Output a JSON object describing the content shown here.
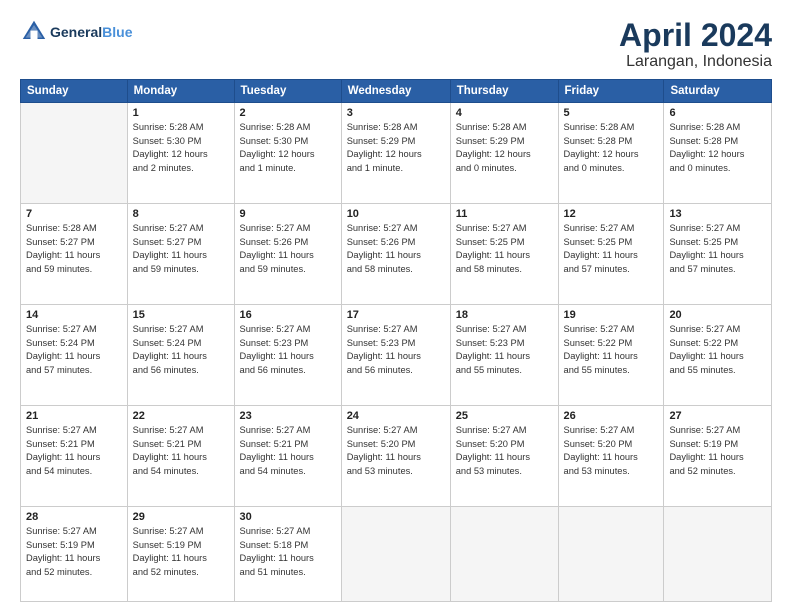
{
  "header": {
    "logo_line1": "General",
    "logo_line2": "Blue",
    "title": "April 2024",
    "subtitle": "Larangan, Indonesia"
  },
  "weekdays": [
    "Sunday",
    "Monday",
    "Tuesday",
    "Wednesday",
    "Thursday",
    "Friday",
    "Saturday"
  ],
  "weeks": [
    [
      {
        "num": "",
        "detail": ""
      },
      {
        "num": "1",
        "detail": "Sunrise: 5:28 AM\nSunset: 5:30 PM\nDaylight: 12 hours\nand 2 minutes."
      },
      {
        "num": "2",
        "detail": "Sunrise: 5:28 AM\nSunset: 5:30 PM\nDaylight: 12 hours\nand 1 minute."
      },
      {
        "num": "3",
        "detail": "Sunrise: 5:28 AM\nSunset: 5:29 PM\nDaylight: 12 hours\nand 1 minute."
      },
      {
        "num": "4",
        "detail": "Sunrise: 5:28 AM\nSunset: 5:29 PM\nDaylight: 12 hours\nand 0 minutes."
      },
      {
        "num": "5",
        "detail": "Sunrise: 5:28 AM\nSunset: 5:28 PM\nDaylight: 12 hours\nand 0 minutes."
      },
      {
        "num": "6",
        "detail": "Sunrise: 5:28 AM\nSunset: 5:28 PM\nDaylight: 12 hours\nand 0 minutes."
      }
    ],
    [
      {
        "num": "7",
        "detail": "Sunrise: 5:28 AM\nSunset: 5:27 PM\nDaylight: 11 hours\nand 59 minutes."
      },
      {
        "num": "8",
        "detail": "Sunrise: 5:27 AM\nSunset: 5:27 PM\nDaylight: 11 hours\nand 59 minutes."
      },
      {
        "num": "9",
        "detail": "Sunrise: 5:27 AM\nSunset: 5:26 PM\nDaylight: 11 hours\nand 59 minutes."
      },
      {
        "num": "10",
        "detail": "Sunrise: 5:27 AM\nSunset: 5:26 PM\nDaylight: 11 hours\nand 58 minutes."
      },
      {
        "num": "11",
        "detail": "Sunrise: 5:27 AM\nSunset: 5:25 PM\nDaylight: 11 hours\nand 58 minutes."
      },
      {
        "num": "12",
        "detail": "Sunrise: 5:27 AM\nSunset: 5:25 PM\nDaylight: 11 hours\nand 57 minutes."
      },
      {
        "num": "13",
        "detail": "Sunrise: 5:27 AM\nSunset: 5:25 PM\nDaylight: 11 hours\nand 57 minutes."
      }
    ],
    [
      {
        "num": "14",
        "detail": "Sunrise: 5:27 AM\nSunset: 5:24 PM\nDaylight: 11 hours\nand 57 minutes."
      },
      {
        "num": "15",
        "detail": "Sunrise: 5:27 AM\nSunset: 5:24 PM\nDaylight: 11 hours\nand 56 minutes."
      },
      {
        "num": "16",
        "detail": "Sunrise: 5:27 AM\nSunset: 5:23 PM\nDaylight: 11 hours\nand 56 minutes."
      },
      {
        "num": "17",
        "detail": "Sunrise: 5:27 AM\nSunset: 5:23 PM\nDaylight: 11 hours\nand 56 minutes."
      },
      {
        "num": "18",
        "detail": "Sunrise: 5:27 AM\nSunset: 5:23 PM\nDaylight: 11 hours\nand 55 minutes."
      },
      {
        "num": "19",
        "detail": "Sunrise: 5:27 AM\nSunset: 5:22 PM\nDaylight: 11 hours\nand 55 minutes."
      },
      {
        "num": "20",
        "detail": "Sunrise: 5:27 AM\nSunset: 5:22 PM\nDaylight: 11 hours\nand 55 minutes."
      }
    ],
    [
      {
        "num": "21",
        "detail": "Sunrise: 5:27 AM\nSunset: 5:21 PM\nDaylight: 11 hours\nand 54 minutes."
      },
      {
        "num": "22",
        "detail": "Sunrise: 5:27 AM\nSunset: 5:21 PM\nDaylight: 11 hours\nand 54 minutes."
      },
      {
        "num": "23",
        "detail": "Sunrise: 5:27 AM\nSunset: 5:21 PM\nDaylight: 11 hours\nand 54 minutes."
      },
      {
        "num": "24",
        "detail": "Sunrise: 5:27 AM\nSunset: 5:20 PM\nDaylight: 11 hours\nand 53 minutes."
      },
      {
        "num": "25",
        "detail": "Sunrise: 5:27 AM\nSunset: 5:20 PM\nDaylight: 11 hours\nand 53 minutes."
      },
      {
        "num": "26",
        "detail": "Sunrise: 5:27 AM\nSunset: 5:20 PM\nDaylight: 11 hours\nand 53 minutes."
      },
      {
        "num": "27",
        "detail": "Sunrise: 5:27 AM\nSunset: 5:19 PM\nDaylight: 11 hours\nand 52 minutes."
      }
    ],
    [
      {
        "num": "28",
        "detail": "Sunrise: 5:27 AM\nSunset: 5:19 PM\nDaylight: 11 hours\nand 52 minutes."
      },
      {
        "num": "29",
        "detail": "Sunrise: 5:27 AM\nSunset: 5:19 PM\nDaylight: 11 hours\nand 52 minutes."
      },
      {
        "num": "30",
        "detail": "Sunrise: 5:27 AM\nSunset: 5:18 PM\nDaylight: 11 hours\nand 51 minutes."
      },
      {
        "num": "",
        "detail": ""
      },
      {
        "num": "",
        "detail": ""
      },
      {
        "num": "",
        "detail": ""
      },
      {
        "num": "",
        "detail": ""
      }
    ]
  ]
}
